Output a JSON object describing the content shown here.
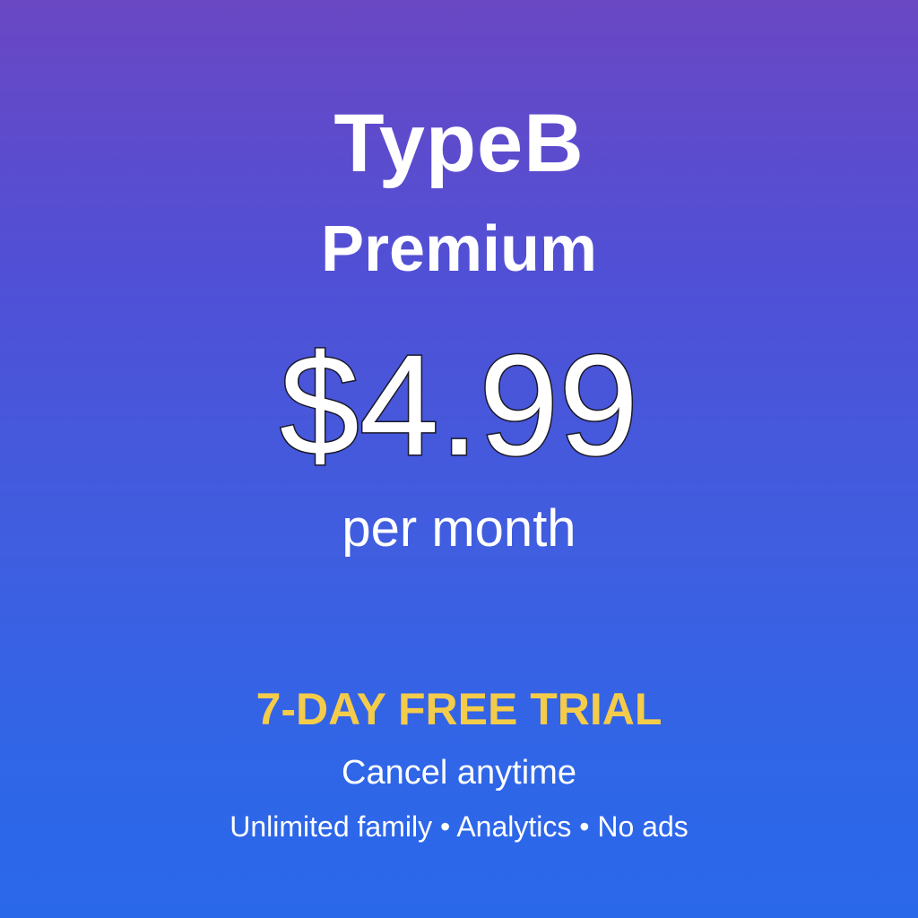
{
  "offer": {
    "brand": "TypeB",
    "tier": "Premium",
    "price": "$4.99",
    "period": "per month",
    "trial": "7-DAY FREE TRIAL",
    "cancel": "Cancel anytime",
    "features": "Unlimited family • Analytics • No ads"
  },
  "colors": {
    "gradient_top": "#6a47c3",
    "gradient_bottom": "#2a68ea",
    "trial_accent": "#f4cc4a",
    "text": "#ffffff"
  }
}
